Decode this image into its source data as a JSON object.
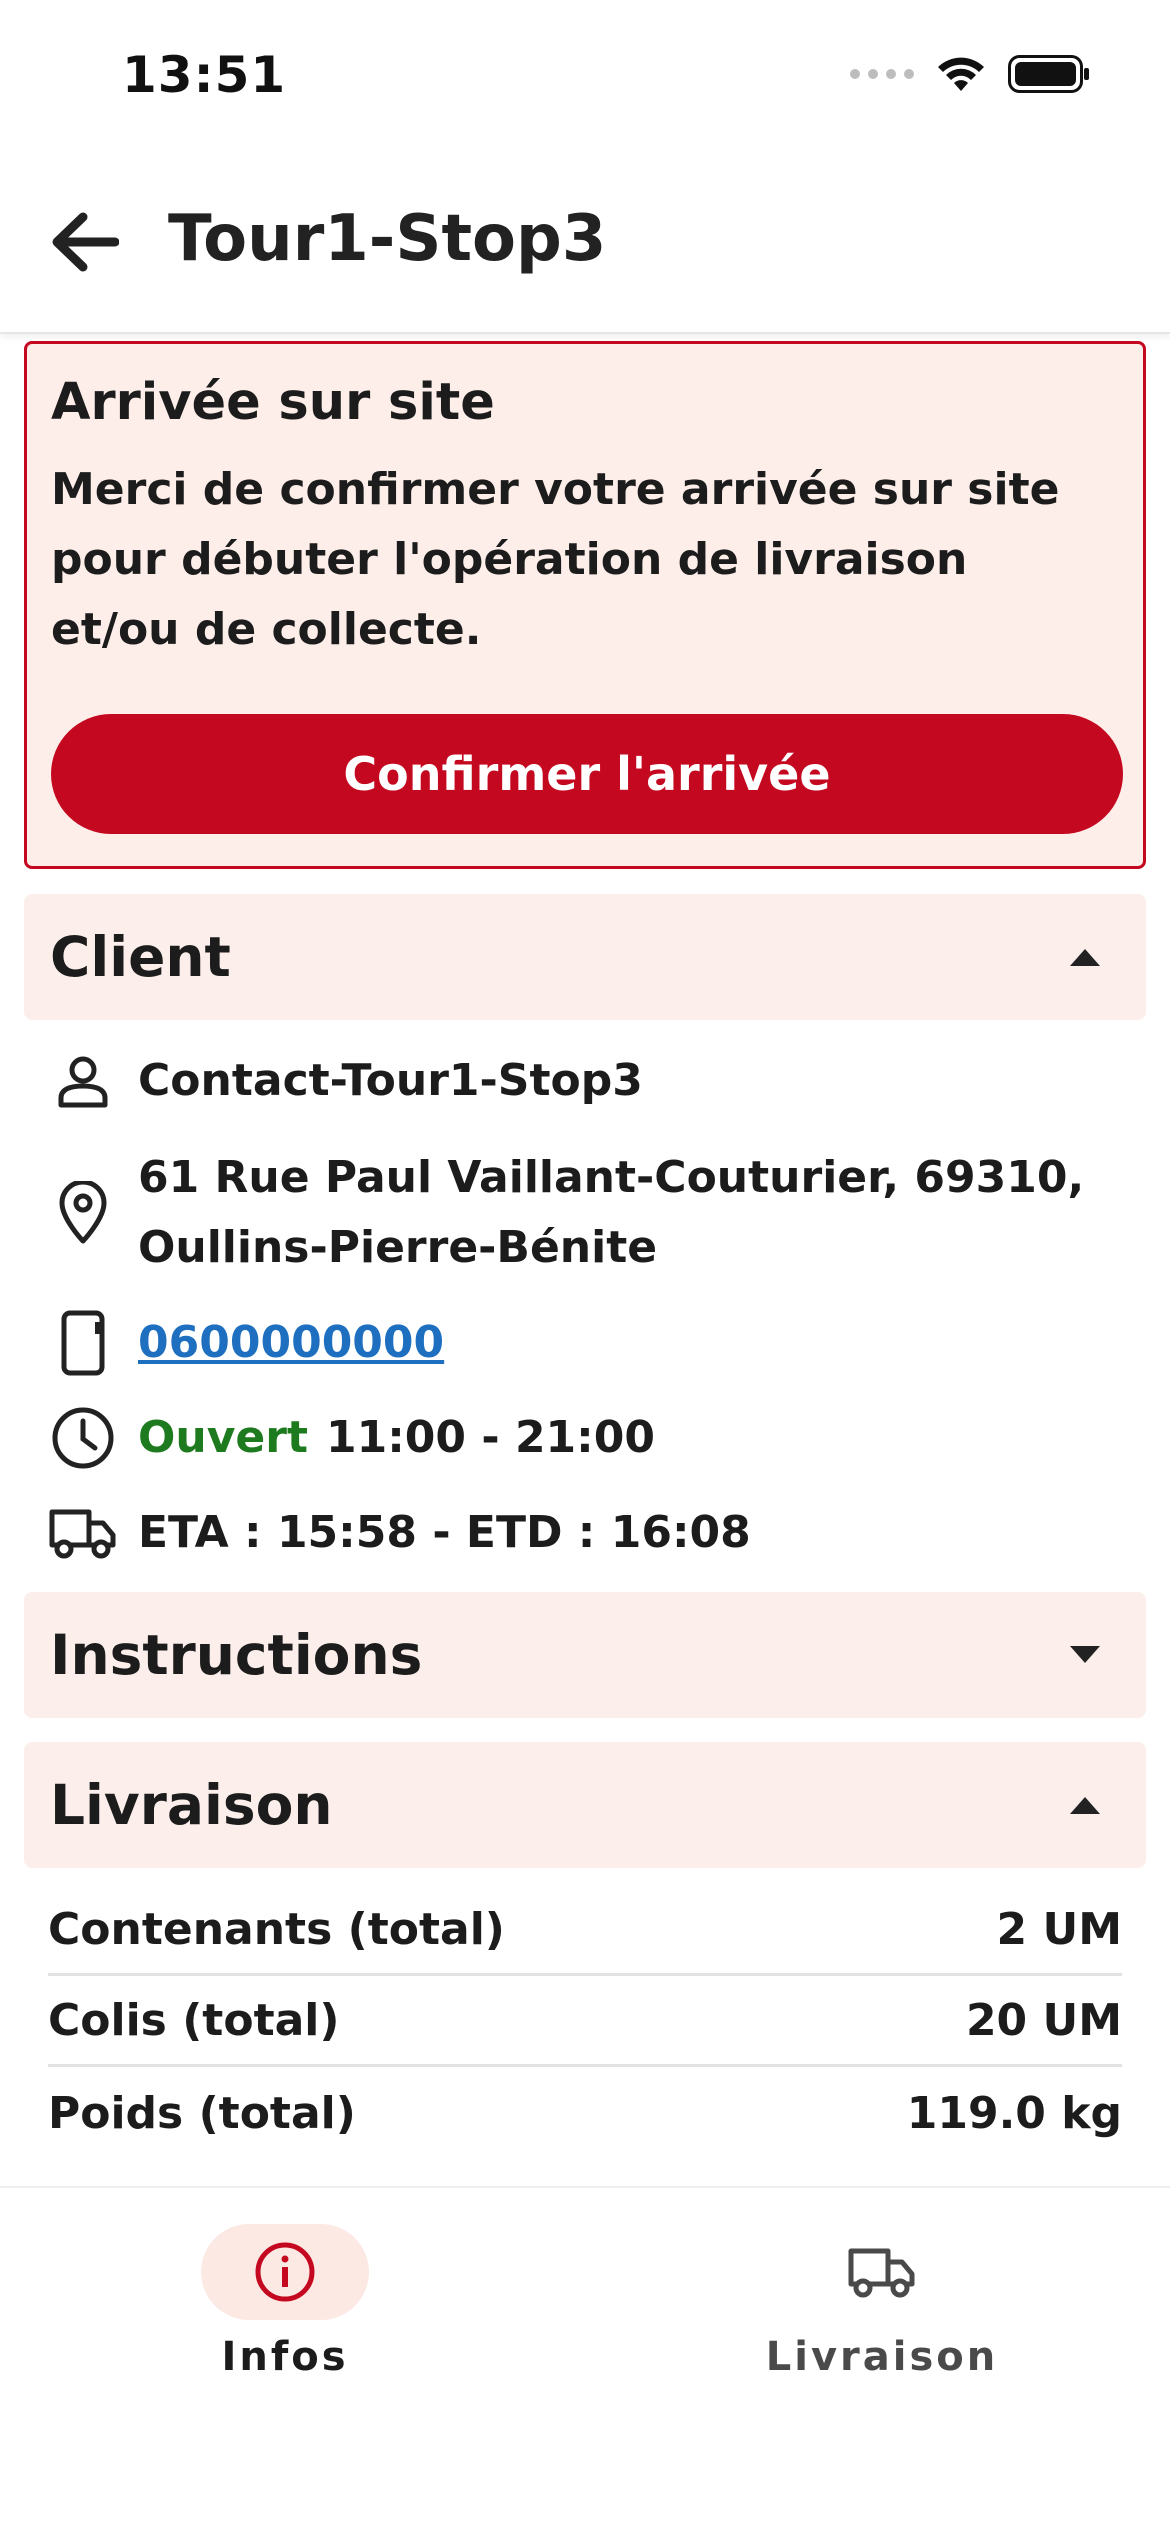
{
  "status_bar": {
    "time": "13:51"
  },
  "header": {
    "title": "Tour1-Stop3",
    "back_icon": "arrow-left-icon"
  },
  "arrival_alert": {
    "title": "Arrivée sur site",
    "message": "Merci de confirmer votre arrivée sur site pour débuter l'opération de livraison et/ou de collecte.",
    "confirm_label": "Confirmer l'arrivée",
    "accent_color": "#c4081f"
  },
  "client": {
    "section_title": "Client",
    "contact": "Contact-Tour1-Stop3",
    "address": "61 Rue Paul Vaillant-Couturier, 69310, Oullins-Pierre-Bénite",
    "phone": "0600000000",
    "open_status": "Ouvert",
    "hours": "11:00 - 21:00",
    "eta_etd": "ETA : 15:58 - ETD : 16:08"
  },
  "instructions": {
    "section_title": "Instructions"
  },
  "delivery": {
    "section_title": "Livraison",
    "rows": [
      {
        "label": "Contenants (total)",
        "value": "2 UM"
      },
      {
        "label": "Colis (total)",
        "value": "20 UM"
      },
      {
        "label": "Poids (total)",
        "value": "119.0 kg"
      }
    ]
  },
  "bottom_nav": {
    "items": [
      {
        "label": "Infos",
        "icon": "info-icon",
        "active": true,
        "color": "#c4081f"
      },
      {
        "label": "Livraison",
        "icon": "truck-icon",
        "active": false,
        "color": "#4a4a4a"
      }
    ]
  }
}
